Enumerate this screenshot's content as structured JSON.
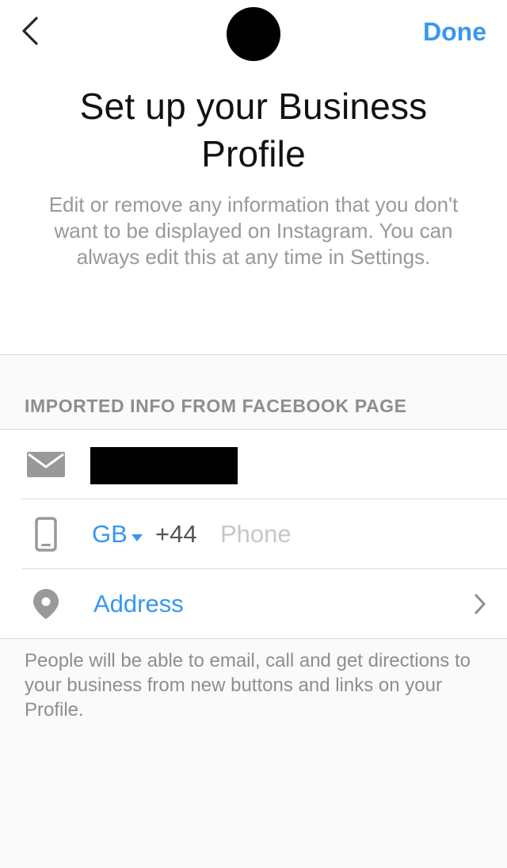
{
  "header": {
    "done_label": "Done"
  },
  "intro": {
    "title": "Set up your Business Profile",
    "subtitle": "Edit or remove any information that you don't want to be displayed on Instagram. You can always edit this at any time in Settings."
  },
  "imported": {
    "section_header": "IMPORTED INFO FROM FACEBOOK PAGE",
    "email": {
      "icon": "mail-icon"
    },
    "phone": {
      "icon": "phone-icon",
      "country_code": "GB",
      "dial_code": "+44",
      "placeholder": "Phone",
      "value": ""
    },
    "address": {
      "icon": "location-pin-icon",
      "label": "Address"
    }
  },
  "footer_note": "People will be able to email, call and get directions to your business from new buttons and links on your Profile.",
  "colors": {
    "accent": "#3897f0",
    "icon_gray": "#999999",
    "divider": "#dbdbdb"
  }
}
